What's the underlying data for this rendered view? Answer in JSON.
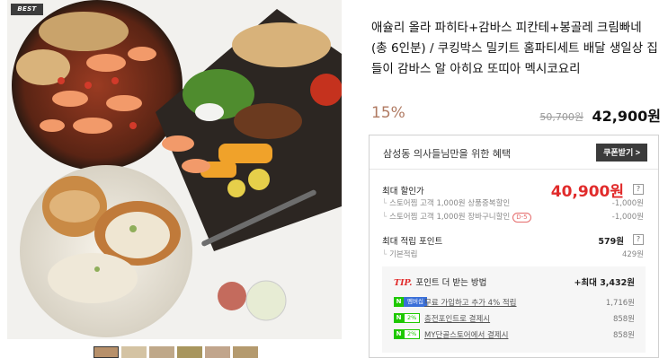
{
  "product": {
    "badge": "BEST",
    "title": "애슐리 올라 파히타+감바스 피칸테+봉골레 크림빠네 (총 6인분) / 쿠킹박스 밀키트 홈파티세트 배달 생일상 집들이 감바스 알 아히요 또띠아 멕시코요리",
    "discount": "15%",
    "original_price": "50,700원",
    "sale_price": "42,900원"
  },
  "benefit": {
    "title": "삼성동 의사들님만을 위한 혜택",
    "coupon_button": "쿠폰받기 >",
    "max_discount_label": "최대 할인가",
    "max_discount_price": "40,900원",
    "discount_items": [
      {
        "label": "스토어찜 고객 1,000원 상품중복할인",
        "value": "-1,000원",
        "badge": ""
      },
      {
        "label": "스토어찜 고객 1,000원 장바구니할인",
        "value": "-1,000원",
        "badge": "D-5"
      }
    ],
    "max_point_label": "최대 적립 포인트",
    "max_point_value": "579원",
    "question_mark": "?",
    "point_items": [
      {
        "label": "기본적립",
        "value": "429원"
      }
    ]
  },
  "tip": {
    "tip_word": "TIP.",
    "label": "포인트 더 받는 방법",
    "total": "+최대 3,432원",
    "items": [
      {
        "n": "N",
        "tag": "멤버십",
        "text": "무료 가입하고 추가 4% 적립",
        "value": "1,716원"
      },
      {
        "n": "N",
        "tag": "2%",
        "text": "충전포인트로 결제시",
        "value": "858원"
      },
      {
        "n": "N",
        "tag": "2%",
        "text": "MY단골스토어에서 결제시",
        "value": "858원"
      }
    ]
  },
  "colors": {
    "accent_red": "#e12b2b",
    "discount_brown": "#b07a62",
    "naver_green": "#1ec800"
  }
}
